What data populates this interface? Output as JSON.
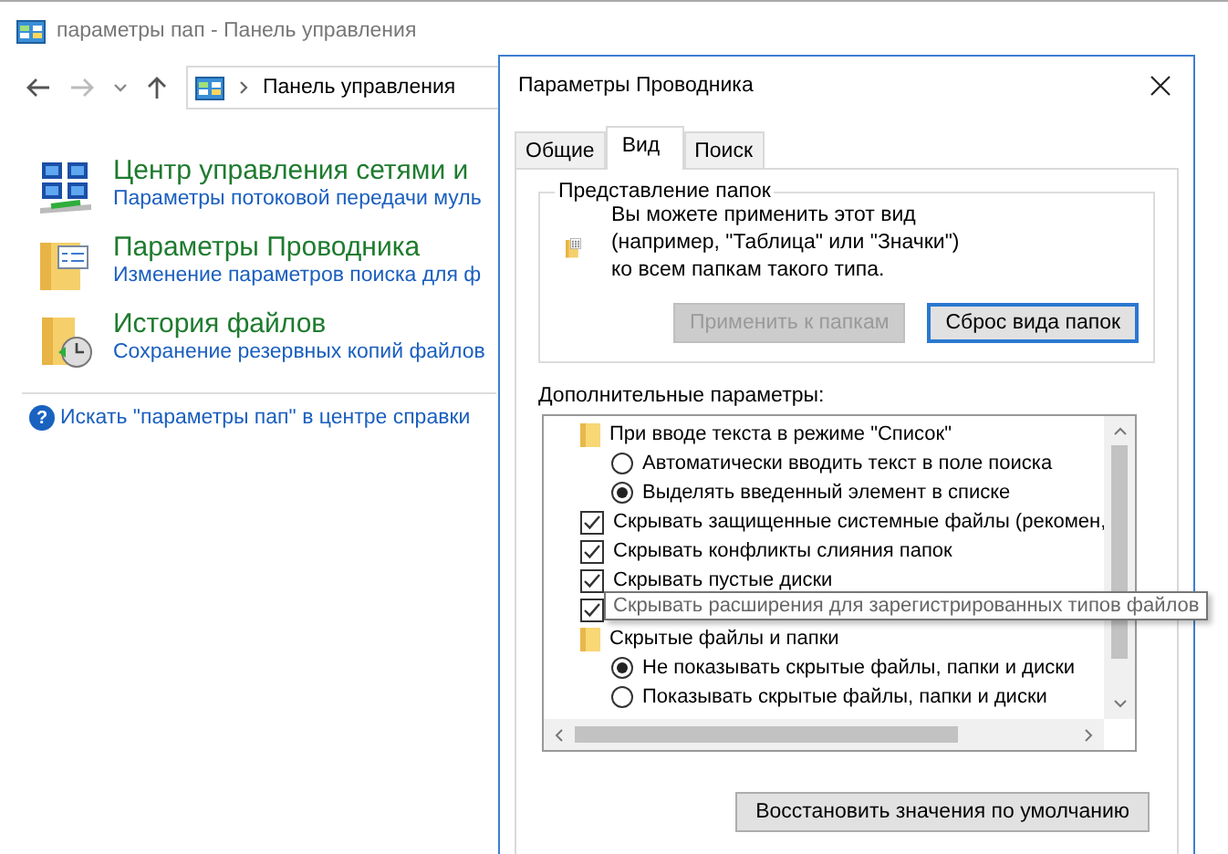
{
  "window": {
    "title": "параметры пап - Панель управления"
  },
  "address_bar": {
    "path": "Панель управления"
  },
  "results": [
    {
      "kind": "network",
      "title": "Центр управления сетями и",
      "link": "Параметры потоковой передачи муль"
    },
    {
      "kind": "folder-options",
      "title": "Параметры Проводника",
      "link": "Изменение параметров поиска для ф"
    },
    {
      "kind": "file-history",
      "title": "История файлов",
      "link": "Сохранение резервных копий файлов"
    }
  ],
  "help": {
    "glyph": "?",
    "link": "Искать \"параметры пап\" в центре справки"
  },
  "dialog": {
    "title": "Параметры Проводника",
    "tabs": [
      {
        "label": "Общие",
        "selected": false
      },
      {
        "label": "Вид",
        "selected": true
      },
      {
        "label": "Поиск",
        "selected": false
      }
    ],
    "folder_views": {
      "legend": "Представление папок",
      "description": "Вы можете применить этот вид (например, \"Таблица\" или \"Значки\") ко всем папкам такого типа.",
      "buttons": [
        {
          "label": "Применить к папкам",
          "disabled": true,
          "focused": false
        },
        {
          "label": "Сброс вида папок",
          "disabled": false,
          "focused": true
        }
      ]
    },
    "advanced_label": "Дополнительные параметры:",
    "tree": [
      {
        "kind": "folder",
        "label": "При вводе текста в режиме \"Список\"",
        "children": [
          {
            "kind": "radio",
            "label": "Автоматически вводить текст в поле поиска",
            "selected": false
          },
          {
            "kind": "radio",
            "label": "Выделять введенный элемент в списке",
            "selected": true
          }
        ]
      },
      {
        "kind": "checkbox",
        "label": "Скрывать защищенные системные файлы (рекомен,",
        "checked": true,
        "tooltip": false
      },
      {
        "kind": "checkbox",
        "label": "Скрывать конфликты слияния папок",
        "checked": true,
        "tooltip": false
      },
      {
        "kind": "checkbox",
        "label": "Скрывать пустые диски",
        "checked": true,
        "tooltip": false
      },
      {
        "kind": "checkbox",
        "label": "Скрывать расширения для зарегистрированных типов файлов",
        "checked": true,
        "tooltip": true
      },
      {
        "kind": "folder",
        "label": "Скрытые файлы и папки",
        "children": [
          {
            "kind": "radio",
            "label": "Не показывать скрытые файлы, папки и диски",
            "selected": true
          },
          {
            "kind": "radio",
            "label": "Показывать скрытые файлы, папки и диски",
            "selected": false
          }
        ]
      }
    ],
    "restore_button": "Восстановить значения по умолчанию"
  }
}
